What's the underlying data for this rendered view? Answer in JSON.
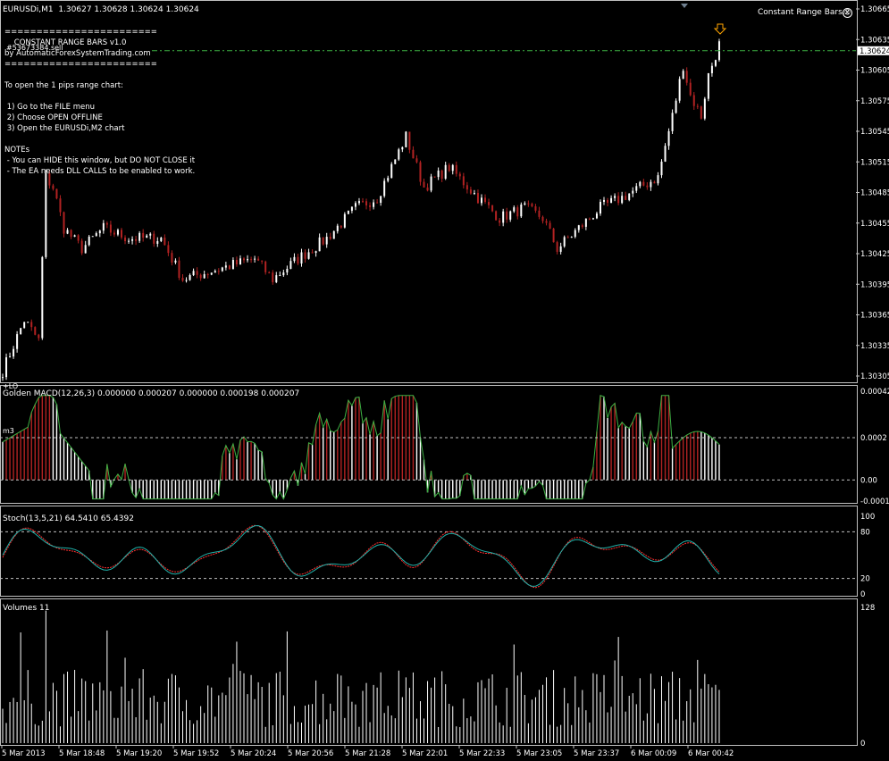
{
  "window": {
    "title": "EURUSDi,M1  1.30627 1.30628 1.30624 1.30624",
    "ea_label": "Constant Range Bars.x",
    "order_label": "#53673384 sell"
  },
  "ea_notes": {
    "lines": [
      "========================",
      "    CONSTANT RANGE BARS v1.0",
      "by AutomaticForexSystemTrading.com",
      "========================",
      "",
      "To open the 1 pips range chart:",
      "",
      " 1) Go to the FILE menu",
      " 2) Choose OPEN OFFLINE",
      " 3) Open the EURUSDi,M2 chart",
      "",
      "NOTEs",
      " - You can HIDE this window, but DO NOT CLOSE it",
      " - The EA needs DLL CALLS to be enabled to work."
    ]
  },
  "price_axis": {
    "ticks": [
      "1.30665",
      "1.30635",
      "1.30605",
      "1.30575",
      "1.30545",
      "1.30515",
      "1.30485",
      "1.30455",
      "1.30425",
      "1.30395",
      "1.30365",
      "1.30335",
      "1.30305"
    ],
    "current": "1.30624"
  },
  "macd": {
    "label": "Golden MACD(12,26,3) 0.000000 0.000207 0.000000 0.000198 0.000207",
    "ticks": [
      "0.00042",
      "0.0002",
      "0.00",
      "-0.0001"
    ],
    "marker_top": "+LO",
    "marker_mid": "m3"
  },
  "stoch": {
    "label": "Stoch(13,5,21) 64.5410 65.4392",
    "ticks": [
      "100",
      "80",
      "20",
      "0"
    ]
  },
  "volumes": {
    "label": "Volumes 11",
    "ticks": [
      "128",
      "0"
    ]
  },
  "time_axis": {
    "labels": [
      "5 Mar 2013",
      "5 Mar 18:48",
      "5 Mar 19:20",
      "5 Mar 19:52",
      "5 Mar 20:24",
      "5 Mar 20:56",
      "5 Mar 21:28",
      "5 Mar 22:01",
      "5 Mar 22:33",
      "5 Mar 23:05",
      "5 Mar 23:37",
      "6 Mar 00:09",
      "6 Mar 00:42"
    ]
  },
  "colors": {
    "bull": "#ffffff",
    "bear": "#b22222",
    "signal_green": "#3cb043",
    "grid": "#c0c0c0",
    "level_line": "#3cb043",
    "stoch_main": "#20b2aa",
    "stoch_signal": "#ff3030"
  },
  "chart_data": {
    "type": "candlestick",
    "symbol": "EURUSDi,M1",
    "bars": 200,
    "close_path": [
      [
        0,
        1.3031
      ],
      [
        6,
        1.3036
      ],
      [
        10,
        1.3034
      ],
      [
        12,
        1.305
      ],
      [
        14,
        1.3049
      ],
      [
        17,
        1.3045
      ],
      [
        22,
        1.3043
      ],
      [
        28,
        1.3045
      ],
      [
        35,
        1.3044
      ],
      [
        44,
        1.3044
      ],
      [
        50,
        1.304
      ],
      [
        60,
        1.3041
      ],
      [
        70,
        1.3042
      ],
      [
        75,
        1.304
      ],
      [
        82,
        1.3042
      ],
      [
        90,
        1.3044
      ],
      [
        98,
        1.3047
      ],
      [
        104,
        1.3048
      ],
      [
        112,
        1.3054
      ],
      [
        117,
        1.3049
      ],
      [
        124,
        1.3051
      ],
      [
        132,
        1.3048
      ],
      [
        138,
        1.3046
      ],
      [
        145,
        1.3047
      ],
      [
        150,
        1.3046
      ],
      [
        154,
        1.3043
      ],
      [
        160,
        1.3045
      ],
      [
        166,
        1.3047
      ],
      [
        172,
        1.3048
      ],
      [
        177,
        1.3049
      ],
      [
        182,
        1.305
      ],
      [
        186,
        1.3056
      ],
      [
        189,
        1.3061
      ],
      [
        191,
        1.3058
      ],
      [
        194,
        1.3056
      ],
      [
        196,
        1.306
      ],
      [
        199,
        1.3063
      ]
    ],
    "price_range": [
      1.30305,
      1.30665
    ],
    "current_price": 1.30624,
    "macd_range": [
      -0.0001,
      0.00042
    ],
    "stoch_levels": [
      80,
      20
    ],
    "volume_max": 128
  }
}
